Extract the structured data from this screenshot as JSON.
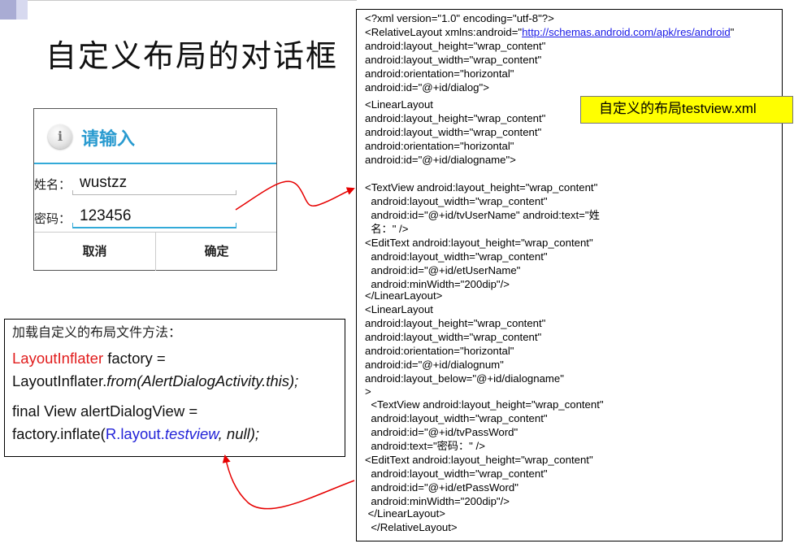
{
  "slide": {
    "title": "自定义布局的对话框",
    "accent_colors": [
      "#a9acd4",
      "#d7d9ef"
    ]
  },
  "dialog": {
    "icon": "info-icon",
    "icon_glyph": "i",
    "title": "请输入",
    "name_label": "姓名：",
    "name_value": "wustzz",
    "password_label": "密码：",
    "password_value": "123456",
    "cancel_label": "取消",
    "ok_label": "确定",
    "accent_color": "#33aad8"
  },
  "code": {
    "l1": "<?xml version=\"1.0\" encoding=\"utf-8\"?>",
    "l2_pre": "<RelativeLayout xmlns:android=\"",
    "l2_link": "http://schemas.android.com/apk/res/android",
    "l2_post": "\"",
    "l3": "android:layout_height=\"wrap_content\"",
    "l4": "android:layout_width=\"wrap_content\"",
    "l5": "android:orientation=\"horizontal\"",
    "l6": "android:id=\"@+id/dialog\">",
    "l7": "<LinearLayout",
    "l8": "android:layout_height=\"wrap_content\"",
    "l9": "android:layout_width=\"wrap_content\"",
    "l10": "android:orientation=\"horizontal\"",
    "l11": "android:id=\"@+id/dialogname\">",
    "l12": "<TextView android:layout_height=\"wrap_content\"",
    "l13": "  android:layout_width=\"wrap_content\"",
    "l14": "  android:id=\"@+id/tvUserName\" android:text=\"姓",
    "l15": "  名：\" />",
    "l16": "<EditText android:layout_height=\"wrap_content\"",
    "l17": "  android:layout_width=\"wrap_content\"",
    "l18": "  android:id=\"@+id/etUserName\"",
    "l19": "  android:minWidth=\"200dip\"/>",
    "l20": "</LinearLayout>",
    "l21": "<LinearLayout",
    "l22": "android:layout_height=\"wrap_content\"",
    "l23": "android:layout_width=\"wrap_content\"",
    "l24": "android:orientation=\"horizontal\"",
    "l25": "android:id=\"@+id/dialognum\"",
    "l26": "android:layout_below=\"@+id/dialogname\"",
    "l27": ">",
    "l28": "  <TextView android:layout_height=\"wrap_content\"",
    "l29": "  android:layout_width=\"wrap_content\"",
    "l30": "  android:id=\"@+id/tvPassWord\"",
    "l31": "  android:text=\"密码：\" />",
    "l32": "<EditText android:layout_height=\"wrap_content\"",
    "l33": "  android:layout_width=\"wrap_content\"",
    "l34": "  android:id=\"@+id/etPassWord\"",
    "l35": "  android:minWidth=\"200dip\"/>",
    "l36": " </LinearLayout>",
    "l37": "  </RelativeLayout>"
  },
  "note": {
    "prefix": "自定义的布局",
    "file": "testview.xml",
    "bg_color": "#ffff00"
  },
  "java": {
    "heading": "加载自定义的布局文件方法：",
    "a1": "LayoutInflater",
    "a2": " factory =",
    "b1": "LayoutInflater.",
    "b2": "from(AlertDialogActivity.this);",
    "c1": "final View alertDialogView =",
    "d1": "factory.inflate(",
    "d2": "R.layout.",
    "d3": "testview",
    "d4": ", null);",
    "highlight_red": "#e11c1c",
    "highlight_blue": "#2424d8"
  },
  "arrows": {
    "color": "#e60000"
  }
}
